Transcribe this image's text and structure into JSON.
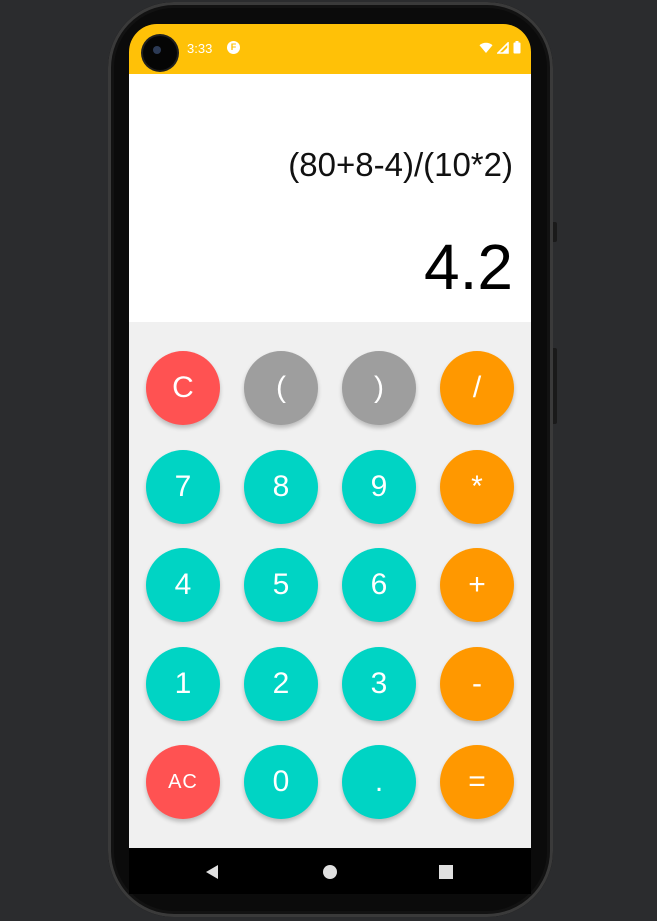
{
  "status_bar": {
    "time": "3:33",
    "app_icon": "notification-app-icon",
    "icons": [
      "wifi-icon",
      "signal-icon",
      "battery-icon"
    ],
    "background_color": "#ffc107"
  },
  "display": {
    "expression": "(80+8-4)/(10*2)",
    "result": "4.2"
  },
  "keypad": {
    "rows": [
      [
        {
          "label": "C",
          "role": "clear"
        },
        {
          "label": "(",
          "role": "paren-open"
        },
        {
          "label": ")",
          "role": "paren-close"
        },
        {
          "label": "/",
          "role": "divide"
        }
      ],
      [
        {
          "label": "7",
          "role": "digit-7"
        },
        {
          "label": "8",
          "role": "digit-8"
        },
        {
          "label": "9",
          "role": "digit-9"
        },
        {
          "label": "*",
          "role": "multiply"
        }
      ],
      [
        {
          "label": "4",
          "role": "digit-4"
        },
        {
          "label": "5",
          "role": "digit-5"
        },
        {
          "label": "6",
          "role": "digit-6"
        },
        {
          "label": "+",
          "role": "plus"
        }
      ],
      [
        {
          "label": "1",
          "role": "digit-1"
        },
        {
          "label": "2",
          "role": "digit-2"
        },
        {
          "label": "3",
          "role": "digit-3"
        },
        {
          "label": "-",
          "role": "minus"
        }
      ],
      [
        {
          "label": "AC",
          "role": "all-clear"
        },
        {
          "label": "0",
          "role": "digit-0"
        },
        {
          "label": ".",
          "role": "decimal"
        },
        {
          "label": "=",
          "role": "equals"
        }
      ]
    ],
    "colors": {
      "clear": "#ff5252",
      "paren": "#9e9e9e",
      "digit": "#00d4c4",
      "operator": "#ff9800"
    }
  },
  "nav_bar": {
    "buttons": [
      "back-icon",
      "home-icon",
      "recents-icon"
    ]
  }
}
